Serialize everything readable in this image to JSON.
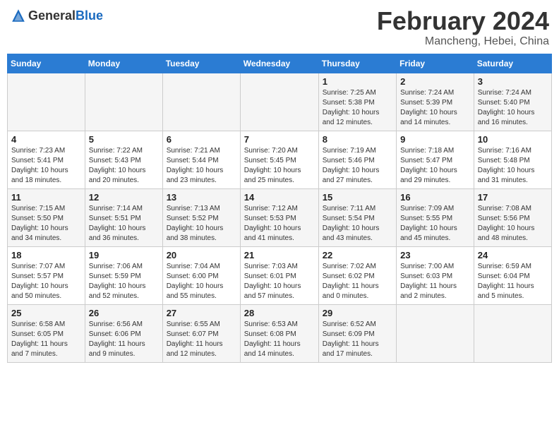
{
  "header": {
    "logo_general": "General",
    "logo_blue": "Blue",
    "month_title": "February 2024",
    "location": "Mancheng, Hebei, China"
  },
  "days_of_week": [
    "Sunday",
    "Monday",
    "Tuesday",
    "Wednesday",
    "Thursday",
    "Friday",
    "Saturday"
  ],
  "weeks": [
    [
      {
        "day": "",
        "info": ""
      },
      {
        "day": "",
        "info": ""
      },
      {
        "day": "",
        "info": ""
      },
      {
        "day": "",
        "info": ""
      },
      {
        "day": "1",
        "info": "Sunrise: 7:25 AM\nSunset: 5:38 PM\nDaylight: 10 hours\nand 12 minutes."
      },
      {
        "day": "2",
        "info": "Sunrise: 7:24 AM\nSunset: 5:39 PM\nDaylight: 10 hours\nand 14 minutes."
      },
      {
        "day": "3",
        "info": "Sunrise: 7:24 AM\nSunset: 5:40 PM\nDaylight: 10 hours\nand 16 minutes."
      }
    ],
    [
      {
        "day": "4",
        "info": "Sunrise: 7:23 AM\nSunset: 5:41 PM\nDaylight: 10 hours\nand 18 minutes."
      },
      {
        "day": "5",
        "info": "Sunrise: 7:22 AM\nSunset: 5:43 PM\nDaylight: 10 hours\nand 20 minutes."
      },
      {
        "day": "6",
        "info": "Sunrise: 7:21 AM\nSunset: 5:44 PM\nDaylight: 10 hours\nand 23 minutes."
      },
      {
        "day": "7",
        "info": "Sunrise: 7:20 AM\nSunset: 5:45 PM\nDaylight: 10 hours\nand 25 minutes."
      },
      {
        "day": "8",
        "info": "Sunrise: 7:19 AM\nSunset: 5:46 PM\nDaylight: 10 hours\nand 27 minutes."
      },
      {
        "day": "9",
        "info": "Sunrise: 7:18 AM\nSunset: 5:47 PM\nDaylight: 10 hours\nand 29 minutes."
      },
      {
        "day": "10",
        "info": "Sunrise: 7:16 AM\nSunset: 5:48 PM\nDaylight: 10 hours\nand 31 minutes."
      }
    ],
    [
      {
        "day": "11",
        "info": "Sunrise: 7:15 AM\nSunset: 5:50 PM\nDaylight: 10 hours\nand 34 minutes."
      },
      {
        "day": "12",
        "info": "Sunrise: 7:14 AM\nSunset: 5:51 PM\nDaylight: 10 hours\nand 36 minutes."
      },
      {
        "day": "13",
        "info": "Sunrise: 7:13 AM\nSunset: 5:52 PM\nDaylight: 10 hours\nand 38 minutes."
      },
      {
        "day": "14",
        "info": "Sunrise: 7:12 AM\nSunset: 5:53 PM\nDaylight: 10 hours\nand 41 minutes."
      },
      {
        "day": "15",
        "info": "Sunrise: 7:11 AM\nSunset: 5:54 PM\nDaylight: 10 hours\nand 43 minutes."
      },
      {
        "day": "16",
        "info": "Sunrise: 7:09 AM\nSunset: 5:55 PM\nDaylight: 10 hours\nand 45 minutes."
      },
      {
        "day": "17",
        "info": "Sunrise: 7:08 AM\nSunset: 5:56 PM\nDaylight: 10 hours\nand 48 minutes."
      }
    ],
    [
      {
        "day": "18",
        "info": "Sunrise: 7:07 AM\nSunset: 5:57 PM\nDaylight: 10 hours\nand 50 minutes."
      },
      {
        "day": "19",
        "info": "Sunrise: 7:06 AM\nSunset: 5:59 PM\nDaylight: 10 hours\nand 52 minutes."
      },
      {
        "day": "20",
        "info": "Sunrise: 7:04 AM\nSunset: 6:00 PM\nDaylight: 10 hours\nand 55 minutes."
      },
      {
        "day": "21",
        "info": "Sunrise: 7:03 AM\nSunset: 6:01 PM\nDaylight: 10 hours\nand 57 minutes."
      },
      {
        "day": "22",
        "info": "Sunrise: 7:02 AM\nSunset: 6:02 PM\nDaylight: 11 hours\nand 0 minutes."
      },
      {
        "day": "23",
        "info": "Sunrise: 7:00 AM\nSunset: 6:03 PM\nDaylight: 11 hours\nand 2 minutes."
      },
      {
        "day": "24",
        "info": "Sunrise: 6:59 AM\nSunset: 6:04 PM\nDaylight: 11 hours\nand 5 minutes."
      }
    ],
    [
      {
        "day": "25",
        "info": "Sunrise: 6:58 AM\nSunset: 6:05 PM\nDaylight: 11 hours\nand 7 minutes."
      },
      {
        "day": "26",
        "info": "Sunrise: 6:56 AM\nSunset: 6:06 PM\nDaylight: 11 hours\nand 9 minutes."
      },
      {
        "day": "27",
        "info": "Sunrise: 6:55 AM\nSunset: 6:07 PM\nDaylight: 11 hours\nand 12 minutes."
      },
      {
        "day": "28",
        "info": "Sunrise: 6:53 AM\nSunset: 6:08 PM\nDaylight: 11 hours\nand 14 minutes."
      },
      {
        "day": "29",
        "info": "Sunrise: 6:52 AM\nSunset: 6:09 PM\nDaylight: 11 hours\nand 17 minutes."
      },
      {
        "day": "",
        "info": ""
      },
      {
        "day": "",
        "info": ""
      }
    ]
  ]
}
